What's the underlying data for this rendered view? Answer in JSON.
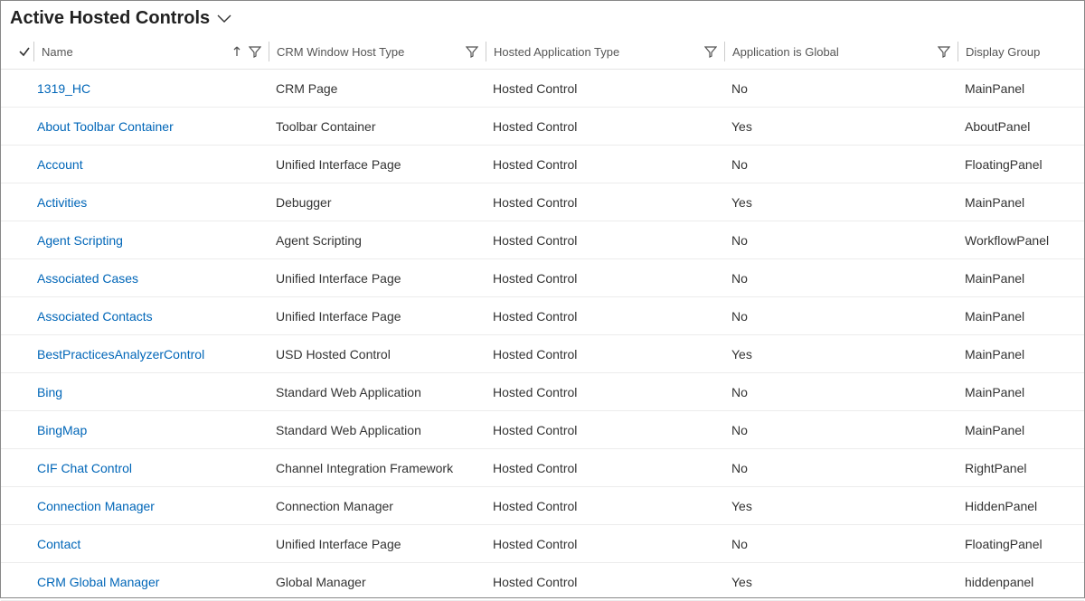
{
  "view": {
    "title": "Active Hosted Controls"
  },
  "columns": [
    {
      "key": "name",
      "label": "Name",
      "sorted": true,
      "filterable": true
    },
    {
      "key": "hosttype",
      "label": "CRM Window Host Type",
      "sorted": false,
      "filterable": true
    },
    {
      "key": "apptype",
      "label": "Hosted Application Type",
      "sorted": false,
      "filterable": true
    },
    {
      "key": "global",
      "label": "Application is Global",
      "sorted": false,
      "filterable": true
    },
    {
      "key": "group",
      "label": "Display Group",
      "sorted": false,
      "filterable": false
    }
  ],
  "rows": [
    {
      "name": "1319_HC",
      "hosttype": "CRM Page",
      "apptype": "Hosted Control",
      "global": "No",
      "group": "MainPanel"
    },
    {
      "name": "About Toolbar Container",
      "hosttype": "Toolbar Container",
      "apptype": "Hosted Control",
      "global": "Yes",
      "group": "AboutPanel"
    },
    {
      "name": "Account",
      "hosttype": "Unified Interface Page",
      "apptype": "Hosted Control",
      "global": "No",
      "group": "FloatingPanel"
    },
    {
      "name": "Activities",
      "hosttype": "Debugger",
      "apptype": "Hosted Control",
      "global": "Yes",
      "group": "MainPanel"
    },
    {
      "name": "Agent Scripting",
      "hosttype": "Agent Scripting",
      "apptype": "Hosted Control",
      "global": "No",
      "group": "WorkflowPanel"
    },
    {
      "name": "Associated Cases",
      "hosttype": "Unified Interface Page",
      "apptype": "Hosted Control",
      "global": "No",
      "group": "MainPanel"
    },
    {
      "name": "Associated Contacts",
      "hosttype": "Unified Interface Page",
      "apptype": "Hosted Control",
      "global": "No",
      "group": "MainPanel"
    },
    {
      "name": "BestPracticesAnalyzerControl",
      "hosttype": "USD Hosted Control",
      "apptype": "Hosted Control",
      "global": "Yes",
      "group": "MainPanel"
    },
    {
      "name": "Bing",
      "hosttype": "Standard Web Application",
      "apptype": "Hosted Control",
      "global": "No",
      "group": "MainPanel"
    },
    {
      "name": "BingMap",
      "hosttype": "Standard Web Application",
      "apptype": "Hosted Control",
      "global": "No",
      "group": "MainPanel"
    },
    {
      "name": "CIF Chat Control",
      "hosttype": "Channel Integration Framework",
      "apptype": "Hosted Control",
      "global": "No",
      "group": "RightPanel"
    },
    {
      "name": "Connection Manager",
      "hosttype": "Connection Manager",
      "apptype": "Hosted Control",
      "global": "Yes",
      "group": "HiddenPanel"
    },
    {
      "name": "Contact",
      "hosttype": "Unified Interface Page",
      "apptype": "Hosted Control",
      "global": "No",
      "group": "FloatingPanel"
    },
    {
      "name": "CRM Global Manager",
      "hosttype": "Global Manager",
      "apptype": "Hosted Control",
      "global": "Yes",
      "group": "hiddenpanel"
    }
  ]
}
